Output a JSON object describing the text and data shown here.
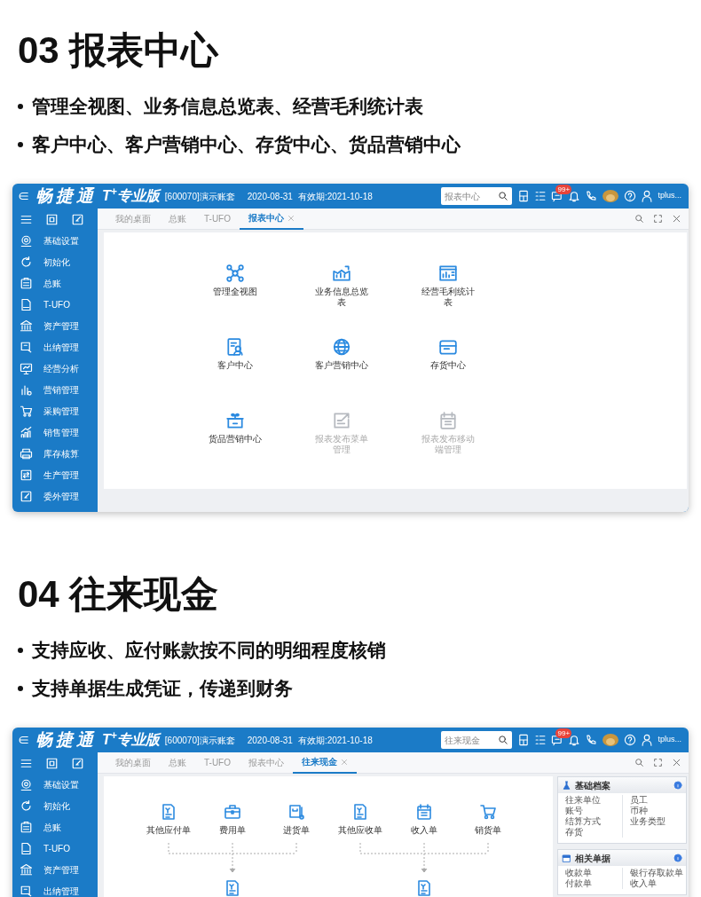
{
  "sections": [
    {
      "title": "03 报表中心",
      "bullets": [
        "管理全视图、业务信息总览表、经营毛利统计表",
        "客户中心、客户营销中心、存货中心、货品营销中心"
      ],
      "app": {
        "brand": "畅捷通",
        "edition": "T$^{+}$专业版",
        "account": "[600070]演示账套",
        "date": "2020-08-31",
        "validity": "有效期:2021-10-18",
        "search": "报表中心",
        "badge": "99+",
        "user": "tplus...",
        "sidebar": [
          "基础设置",
          "初始化",
          "总账",
          "T-UFO",
          "资产管理",
          "出纳管理",
          "经营分析",
          "营销管理",
          "采购管理",
          "销售管理",
          "库存核算",
          "生产管理",
          "委外管理"
        ],
        "tabs": [
          {
            "label": "我的桌面",
            "selected": false,
            "closable": false
          },
          {
            "label": "总账",
            "selected": false,
            "closable": false
          },
          {
            "label": "T-UFO",
            "selected": false,
            "closable": false
          },
          {
            "label": "报表中心",
            "selected": true,
            "closable": true
          }
        ],
        "content": {
          "kind": "grid",
          "items": [
            {
              "label": "管理全视图",
              "disabled": false
            },
            {
              "label": "业务信息总览表",
              "disabled": false
            },
            {
              "label": "经营毛利统计表",
              "disabled": false
            },
            {
              "label": "客户中心",
              "disabled": false
            },
            {
              "label": "客户营销中心",
              "disabled": false
            },
            {
              "label": "存货中心",
              "disabled": false
            },
            {
              "label": "货品营销中心",
              "disabled": false
            },
            {
              "label": "报表发布菜单管理",
              "disabled": true
            },
            {
              "label": "报表发布移动端管理",
              "disabled": true
            }
          ]
        }
      }
    },
    {
      "title": "04 往来现金",
      "bullets": [
        "支持应收、应付账款按不同的明细程度核销",
        "支持单据生成凭证，传递到财务"
      ],
      "app": {
        "brand": "畅捷通",
        "edition": "T$^{+}$专业版",
        "account": "[600070]演示账套",
        "date": "2020-08-31",
        "validity": "有效期:2021-10-18",
        "search": "往来现金",
        "badge": "99+",
        "user": "tplus...",
        "sidebar": [
          "基础设置",
          "初始化",
          "总账",
          "T-UFO",
          "资产管理",
          "出纳管理"
        ],
        "tabs": [
          {
            "label": "我的桌面",
            "selected": false,
            "closable": false
          },
          {
            "label": "总账",
            "selected": false,
            "closable": false
          },
          {
            "label": "T-UFO",
            "selected": false,
            "closable": false
          },
          {
            "label": "报表中心",
            "selected": false,
            "closable": false
          },
          {
            "label": "往来现金",
            "selected": true,
            "closable": true
          }
        ],
        "content": {
          "kind": "flow",
          "groups": [
            {
              "items": [
                "其他应付单",
                "费用单",
                "进货单"
              ]
            },
            {
              "items": [
                "其他应收单",
                "收入单",
                "销货单"
              ]
            }
          ],
          "panels": [
            {
              "title": "基础档案",
              "columns": [
                [
                  "往来单位",
                  "账号",
                  "结算方式",
                  "存货"
                ],
                [
                  "员工",
                  "币种",
                  "业务类型"
                ]
              ]
            },
            {
              "title": "相关单据",
              "columns": [
                [
                  "收款单",
                  "付款单"
                ],
                [
                  "银行存取款单",
                  "收入单"
                ]
              ]
            }
          ]
        }
      }
    }
  ]
}
